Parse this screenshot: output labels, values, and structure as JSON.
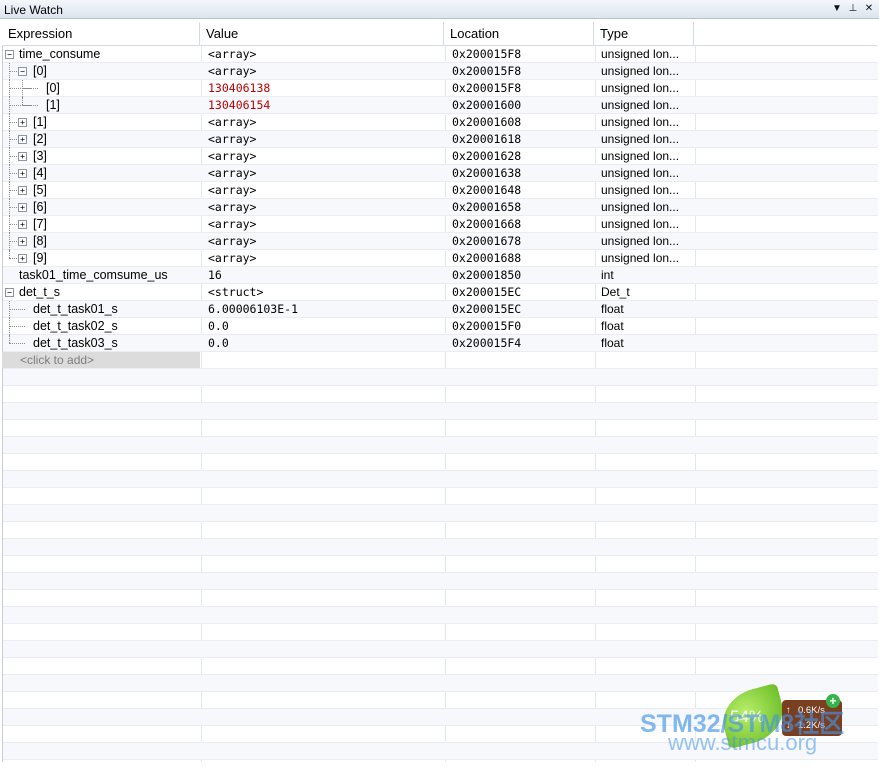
{
  "window": {
    "title": "Live Watch",
    "btn_menu": "▼",
    "btn_pin": "⊥",
    "btn_close": "✕"
  },
  "columns": {
    "expression": "Expression",
    "value": "Value",
    "location": "Location",
    "type": "Type"
  },
  "rows": [
    {
      "expr": "time_consume",
      "value": "<array>",
      "location": "0x200015F8",
      "type": "unsigned lon...",
      "red": false
    },
    {
      "expr": "[0]",
      "value": "<array>",
      "location": "0x200015F8",
      "type": "unsigned lon...",
      "red": false
    },
    {
      "expr": "[0]",
      "value": "130406138",
      "location": "0x200015F8",
      "type": "unsigned lon...",
      "red": true
    },
    {
      "expr": "[1]",
      "value": "130406154",
      "location": "0x20001600",
      "type": "unsigned lon...",
      "red": true
    },
    {
      "expr": "[1]",
      "value": "<array>",
      "location": "0x20001608",
      "type": "unsigned lon...",
      "red": false
    },
    {
      "expr": "[2]",
      "value": "<array>",
      "location": "0x20001618",
      "type": "unsigned lon...",
      "red": false
    },
    {
      "expr": "[3]",
      "value": "<array>",
      "location": "0x20001628",
      "type": "unsigned lon...",
      "red": false
    },
    {
      "expr": "[4]",
      "value": "<array>",
      "location": "0x20001638",
      "type": "unsigned lon...",
      "red": false
    },
    {
      "expr": "[5]",
      "value": "<array>",
      "location": "0x20001648",
      "type": "unsigned lon...",
      "red": false
    },
    {
      "expr": "[6]",
      "value": "<array>",
      "location": "0x20001658",
      "type": "unsigned lon...",
      "red": false
    },
    {
      "expr": "[7]",
      "value": "<array>",
      "location": "0x20001668",
      "type": "unsigned lon...",
      "red": false
    },
    {
      "expr": "[8]",
      "value": "<array>",
      "location": "0x20001678",
      "type": "unsigned lon...",
      "red": false
    },
    {
      "expr": "[9]",
      "value": "<array>",
      "location": "0x20001688",
      "type": "unsigned lon...",
      "red": false
    },
    {
      "expr": "task01_time_comsume_us",
      "value": "16",
      "location": "0x20001850",
      "type": "int",
      "red": false
    },
    {
      "expr": "det_t_s",
      "value": "<struct>",
      "location": "0x200015EC",
      "type": "Det_t",
      "red": false
    },
    {
      "expr": "det_t_task01_s",
      "value": "6.00006103E-1",
      "location": "0x200015EC",
      "type": "float",
      "red": false
    },
    {
      "expr": "det_t_task02_s",
      "value": "0.0",
      "location": "0x200015F0",
      "type": "float",
      "red": false
    },
    {
      "expr": "det_t_task03_s",
      "value": "0.0",
      "location": "0x200015F4",
      "type": "float",
      "red": false
    }
  ],
  "add_row": {
    "placeholder": "<click to add>"
  },
  "toggles": {
    "expanded": "−",
    "collapsed": "+"
  },
  "overlay": {
    "cpu_percent": "54%",
    "upload": "0.6K/s",
    "download": "1.2K/s",
    "plus": "+",
    "up_arrow": "↑",
    "down_arrow": "↓"
  },
  "watermark": {
    "line1": "STM32/STM8社区",
    "line2": "www.stmcu.org"
  },
  "colors": {
    "red_value": "#c00000",
    "header_bg": "#ffffff",
    "title_bg": "#dde5ef"
  }
}
